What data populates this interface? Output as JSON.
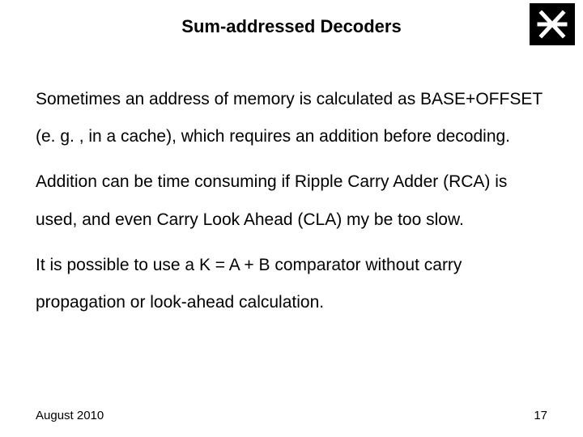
{
  "title": "Sum-addressed Decoders",
  "paragraphs": {
    "p1": "Sometimes an address of memory is calculated as BASE+OFFSET (e. g. , in a cache), which requires an addition before decoding.",
    "p2": "Addition can be time consuming if Ripple Carry Adder (RCA) is used, and even Carry Look Ahead (CLA) my be too slow.",
    "p3": "It is possible to use a K = A + B comparator without carry propagation or look-ahead calculation."
  },
  "footer": {
    "date": "August 2010",
    "page": "17"
  }
}
